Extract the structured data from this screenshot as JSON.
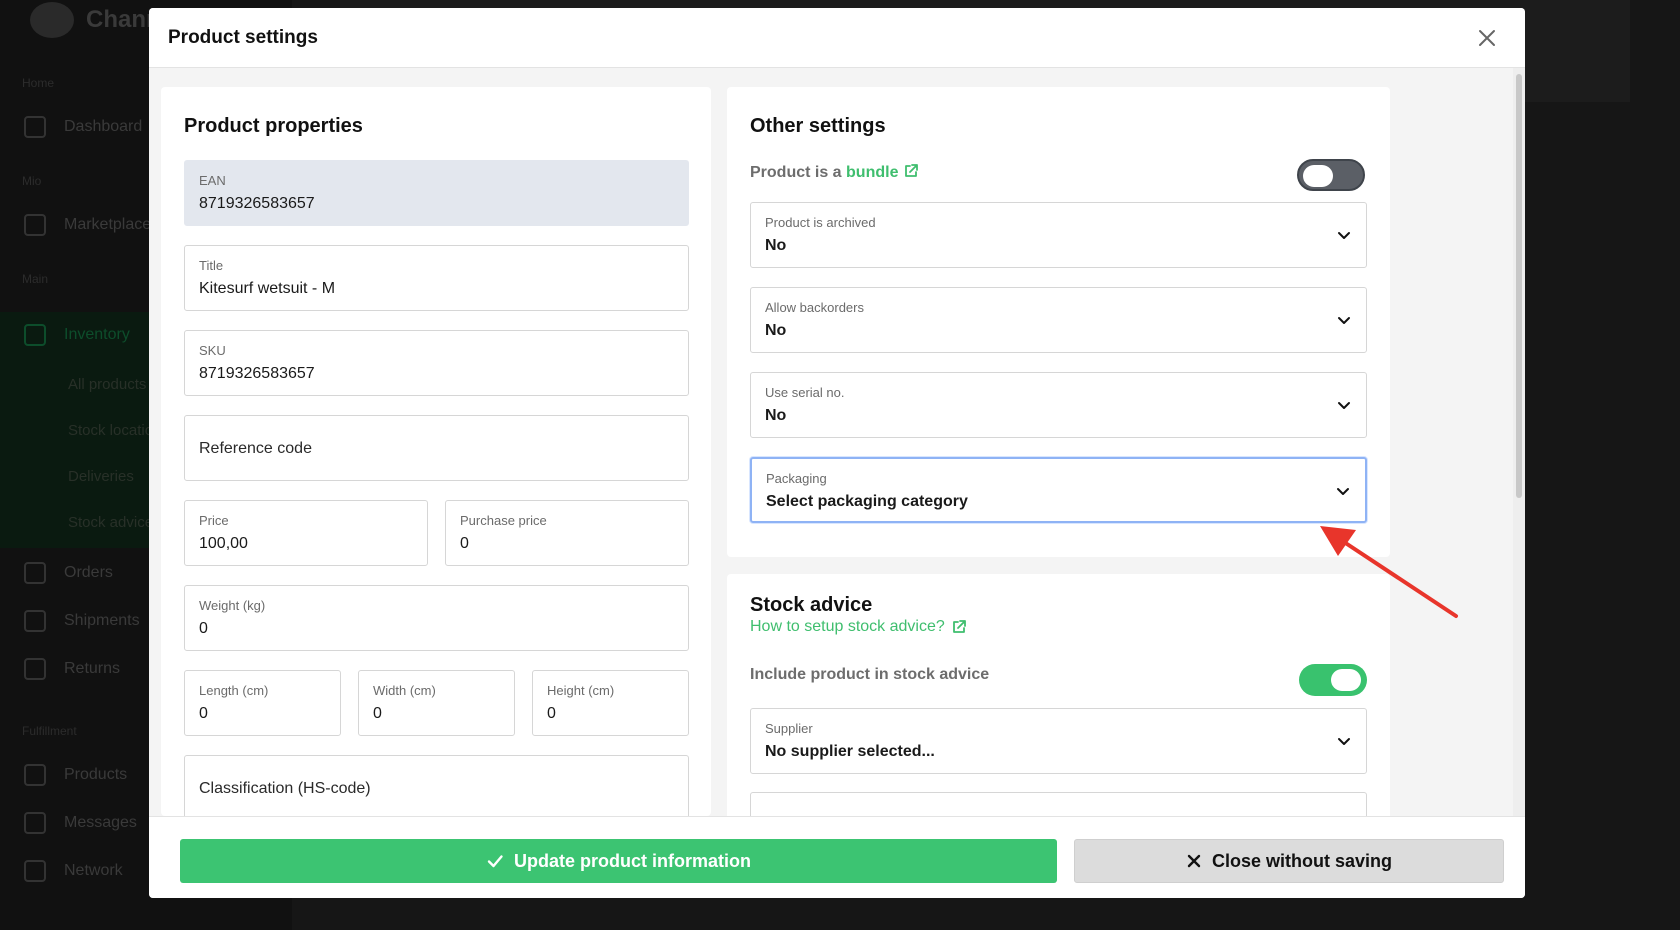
{
  "background": {
    "app_name": "ChannelDock",
    "sidebar_sections": [
      "Home",
      "Mio",
      "Main",
      "Fulfillment"
    ],
    "sidebar_items": [
      "Dashboard",
      "Marketplaces",
      "Inventory",
      "Orders",
      "Shipments",
      "Returns",
      "Products",
      "Messages",
      "Network"
    ],
    "inventory_subitems": [
      "All products",
      "Stock locations",
      "Deliveries",
      "Stock advice"
    ]
  },
  "modal": {
    "title": "Product settings",
    "close_icon": "close-icon"
  },
  "product_properties": {
    "heading": "Product properties",
    "ean": {
      "label": "EAN",
      "value": "8719326583657"
    },
    "title": {
      "label": "Title",
      "value": "Kitesurf wetsuit - M"
    },
    "sku": {
      "label": "SKU",
      "value": "8719326583657"
    },
    "reference_code": {
      "placeholder": "Reference code"
    },
    "price": {
      "label": "Price",
      "value": "100,00"
    },
    "purchase_price": {
      "label": "Purchase price",
      "value": "0"
    },
    "weight": {
      "label": "Weight (kg)",
      "value": "0"
    },
    "length": {
      "label": "Length (cm)",
      "value": "0"
    },
    "width": {
      "label": "Width (cm)",
      "value": "0"
    },
    "height": {
      "label": "Height (cm)",
      "value": "0"
    },
    "classification": {
      "placeholder": "Classification (HS-code)"
    }
  },
  "other_settings": {
    "heading": "Other settings",
    "bundle_prefix": "Product is a",
    "bundle_link": "bundle",
    "bundle_toggle": "off",
    "archived": {
      "label": "Product is archived",
      "value": "No"
    },
    "backorders": {
      "label": "Allow backorders",
      "value": "No"
    },
    "serial": {
      "label": "Use serial no.",
      "value": "No"
    },
    "packaging": {
      "label": "Packaging",
      "value": "Select packaging category"
    }
  },
  "stock_advice": {
    "heading": "Stock advice",
    "help_link": "How to setup stock advice?",
    "include_label": "Include product in stock advice",
    "include_toggle": "on",
    "supplier": {
      "label": "Supplier",
      "value": "No supplier selected..."
    }
  },
  "footer": {
    "update_label": "Update product information",
    "close_label": "Close without saving"
  },
  "colors": {
    "accent_green": "#3cc472",
    "focus_blue": "#8fb3f5",
    "annotation_red": "#e8352b"
  }
}
